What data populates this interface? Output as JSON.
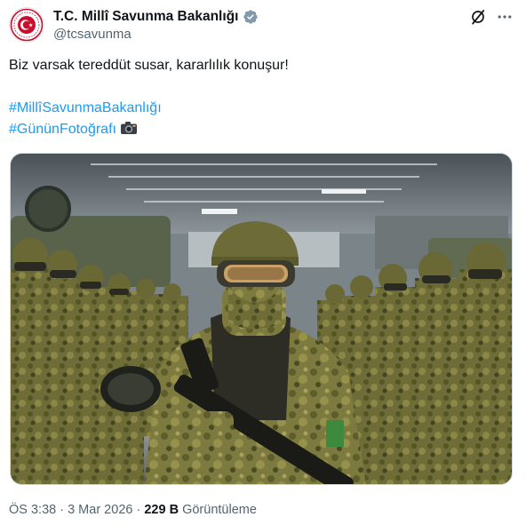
{
  "account": {
    "display_name": "T.C. Millî Savunma Bakanlığı",
    "handle": "@tcsavunma",
    "verified": true,
    "verified_color": "#829aab",
    "avatar_icon": "turkish-defense-emblem-icon"
  },
  "header_actions": {
    "grok_icon": "grok-icon",
    "more_icon": "more-options-icon"
  },
  "post": {
    "text": "Biz varsak tereddüt susar, kararlılık konuşur!",
    "hashtags": [
      "#MillîSavunmaBakanlığı",
      "#GününFotoğrafı"
    ],
    "camera_icon": "camera-emoji-icon",
    "hashtag_color": "#1d9bf0"
  },
  "media": {
    "description_icon": "soldiers-photo-image"
  },
  "meta": {
    "time": "ÖS 3:38",
    "separator": " · ",
    "date": "3 Mar 2026",
    "views_count": "229 B",
    "views_label": "Görüntüleme"
  }
}
